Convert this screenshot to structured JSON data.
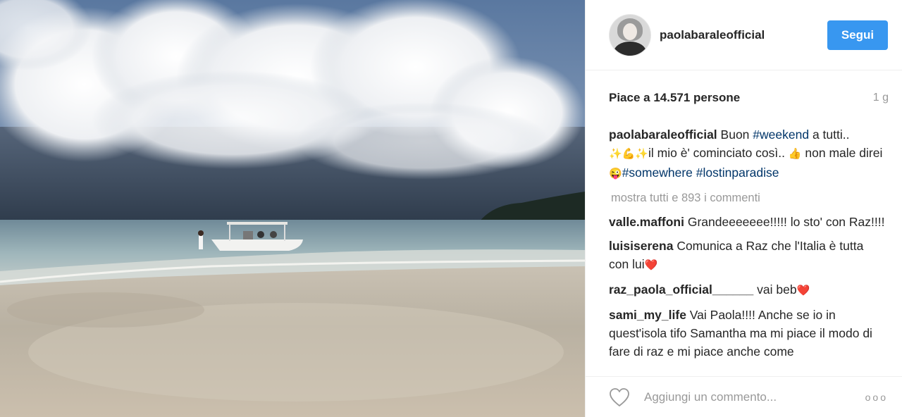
{
  "post": {
    "username": "paolabaraleofficial",
    "follow_label": "Segui",
    "likes_text": "Piace a 14.571 persone",
    "time_ago": "1 g",
    "caption": {
      "user": "paolabaraleofficial",
      "t1": " Buon ",
      "tag1": "#weekend",
      "t2": " a tutti..",
      "e1": "✨💪✨",
      "t3": "il mio è' cominciato così.. ",
      "e2": "👍",
      "t4": " non male direi ",
      "e3": "😜",
      "tag2": "#somewhere",
      "t5": " ",
      "tag3": "#lostinparadise"
    },
    "show_all": "mostra tutti e 893 i commenti",
    "comments": [
      {
        "user": "valle.maffoni",
        "text": " Grandeeeeeee!!!!! lo sto' con Raz!!!!",
        "emoji": ""
      },
      {
        "user": "luisiserena",
        "text": " Comunica a Raz che l'Italia è tutta con lui",
        "emoji": "❤️"
      },
      {
        "user": "raz_paola_official______",
        "text": " vai beb",
        "emoji": "❤️"
      },
      {
        "user": "sami_my_life",
        "text": " Vai Paola!!!! Anche se io in quest'isola tifo Samantha ma mi piace il modo di fare di raz e mi piace anche come",
        "emoji": ""
      }
    ],
    "add_comment_placeholder": "Aggiungi un commento...",
    "more_options": "ooo",
    "colors": {
      "follow": "#3897f0",
      "hashtag": "#003569",
      "muted": "#999999"
    }
  }
}
